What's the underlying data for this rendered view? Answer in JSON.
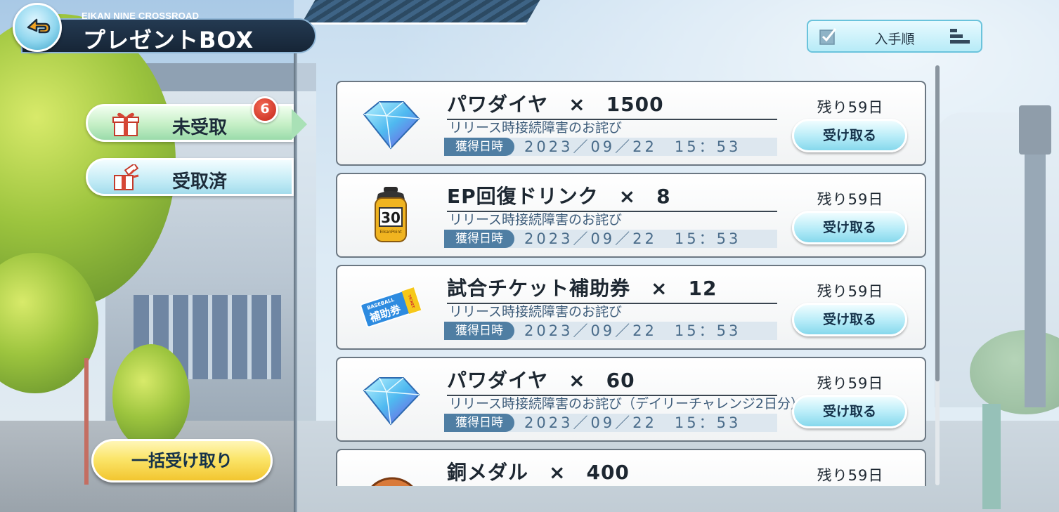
{
  "header": {
    "subtitle": "EIKAN NINE CROSSROAD",
    "title": "プレゼントBOX"
  },
  "sort": {
    "label": "入手順"
  },
  "tabs": [
    {
      "label": "未受取",
      "active": true,
      "icon": "gift-icon"
    },
    {
      "label": "受取済",
      "active": false,
      "icon": "opened-gift-icon"
    }
  ],
  "badge": {
    "count": "6"
  },
  "bulk_button": {
    "label": "一括受け取り"
  },
  "items": [
    {
      "icon": "diamond-icon",
      "name": "パワダイヤ　×　1500",
      "desc": "リリース時接続障害のお詫び",
      "date_label": "獲得日時",
      "date": "2023／09／22　15：53",
      "remain": "残り59日",
      "button": "受け取る"
    },
    {
      "icon": "drink-bottle-icon",
      "name": "EP回復ドリンク　×　8",
      "desc": "リリース時接続障害のお詫び",
      "date_label": "獲得日時",
      "date": "2023／09／22　15：53",
      "remain": "残り59日",
      "button": "受け取る"
    },
    {
      "icon": "ticket-icon",
      "name": "試合チケット補助券　×　12",
      "desc": "リリース時接続障害のお詫び",
      "date_label": "獲得日時",
      "date": "2023／09／22　15：53",
      "remain": "残り59日",
      "button": "受け取る"
    },
    {
      "icon": "diamond-icon",
      "name": "パワダイヤ　×　60",
      "desc": "リリース時接続障害のお詫び（デイリーチャレンジ2日分）",
      "date_label": "獲得日時",
      "date": "2023／09／22　15：53",
      "remain": "残り59日",
      "button": "受け取る"
    },
    {
      "icon": "bronze-medal-icon",
      "name": "銅メダル　×　400",
      "desc": "",
      "date_label": "",
      "date": "",
      "remain": "残り59日",
      "button": ""
    }
  ],
  "ticket_icon_text": {
    "top": "BASEBALL",
    "main": "補助券",
    "side": "TICKET"
  },
  "bottle_icon_text": {
    "num": "30",
    "sub": "EikanPoint"
  },
  "colors": {
    "header_bg": "#1c2f44",
    "tab_active": "#c5efc6",
    "tab_inactive": "#c4ecf6",
    "badge": "#d9392a",
    "bulk_button": "#f7d548",
    "receive_button": "#a9e4f3",
    "date_tag": "#4f7ea3"
  }
}
